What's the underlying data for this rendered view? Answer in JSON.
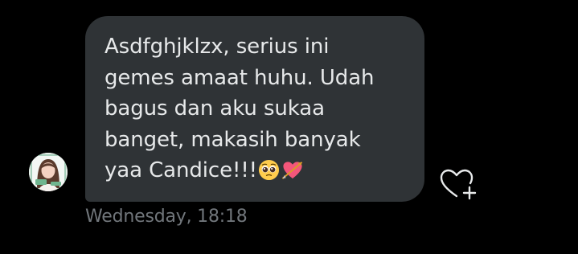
{
  "message": {
    "text": "Asdfghjklzx, serius ini\ngemes amaat huhu. Udah\nbagus dan aku sukaa\nbanget, makasih banyak\nyaa Candice!!!",
    "emojis": [
      "pleading-face",
      "heart-with-arrow"
    ],
    "timestamp": "Wednesday, 18:18"
  },
  "reaction": {
    "icon": "heart-plus-icon"
  },
  "colors": {
    "background": "#000000",
    "bubble": "#2f3336",
    "text": "#e7e9ea",
    "timestamp": "#71767b",
    "icon": "#e7e9ea"
  }
}
